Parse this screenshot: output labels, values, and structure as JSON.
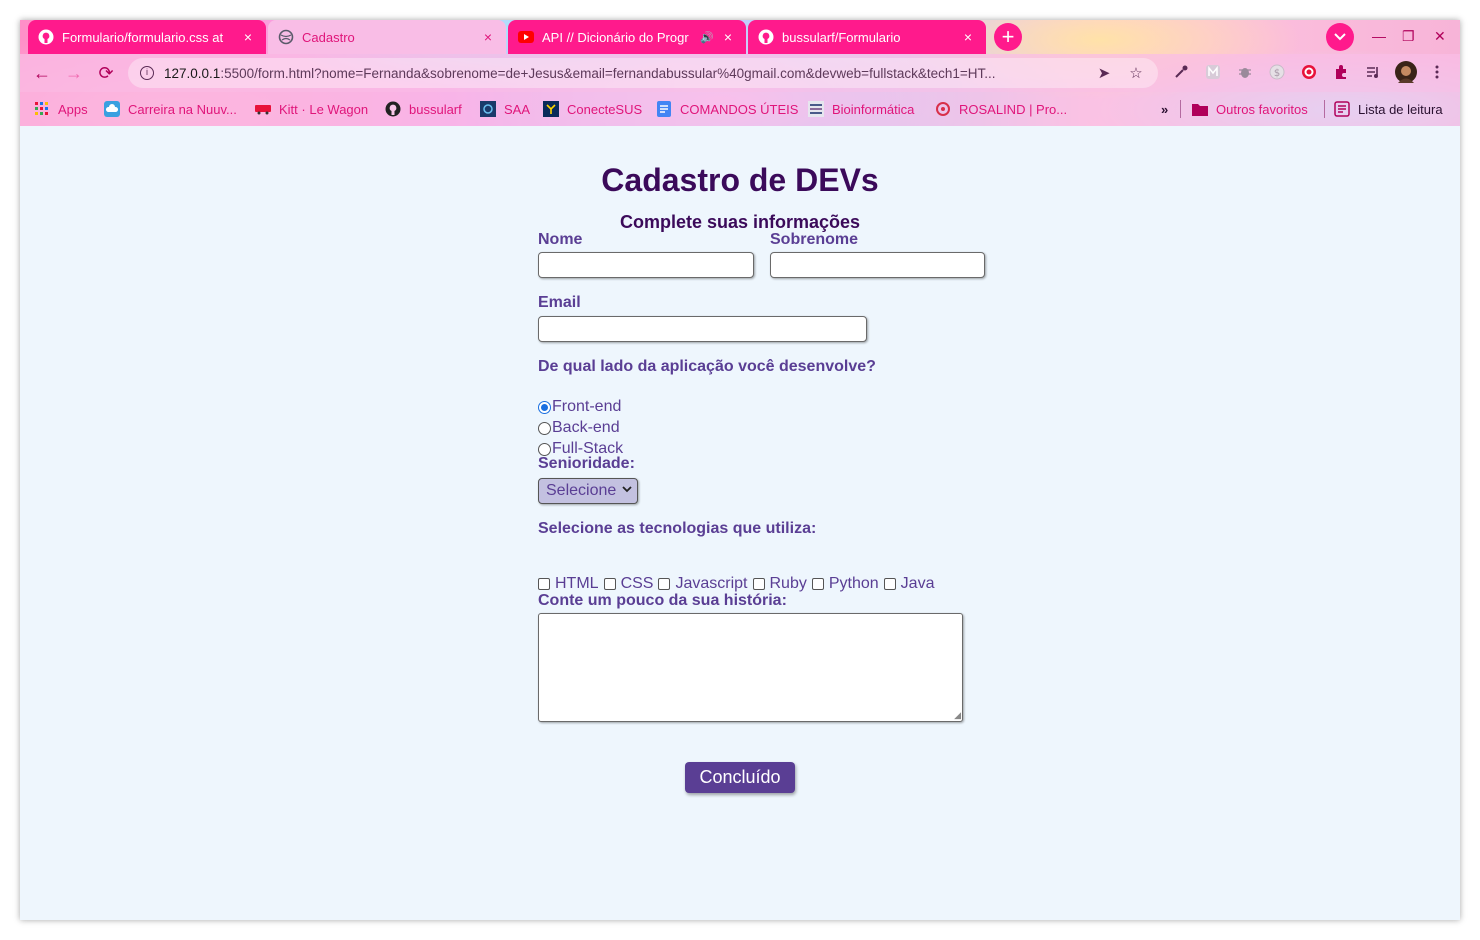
{
  "tabs": [
    {
      "title": "Formulario/formulario.css at",
      "favicon": "github-icon",
      "close": "×"
    },
    {
      "title": "Cadastro",
      "favicon": "globe-icon",
      "close": "×"
    },
    {
      "title": "API // Dicionário do Progr",
      "favicon": "youtube-icon",
      "close": "×",
      "audio": "🔊"
    },
    {
      "title": "bussularf/Formulario",
      "favicon": "github-icon",
      "close": "×"
    }
  ],
  "new_tab": "+",
  "tab_search": "⌄",
  "window_controls": {
    "minimize": "—",
    "restore": "❐",
    "close": "✕"
  },
  "nav": {
    "back": "←",
    "forward": "→",
    "reload": "⟳"
  },
  "address_bar": {
    "host": "127.0.0.1",
    "rest": ":5500/form.html?nome=Fernanda&sobrenome=de+Jesus&email=fernandabussular%40gmail.com&devweb=fullstack&tech1=HT...",
    "info_glyph": "i",
    "send_glyph": "➤",
    "star_glyph": "☆"
  },
  "extensions": [
    "eyedropper-icon",
    "m-extension-icon",
    "bug-icon",
    "dollar-icon",
    "target-icon",
    "puzzle-icon",
    "media-icon",
    "profile-avatar",
    "menu-icon"
  ],
  "bookmarks": [
    {
      "label": "Apps",
      "icon": "apps-grid-icon"
    },
    {
      "label": "Carreira na Nuuv...",
      "icon": "cloud-icon"
    },
    {
      "label": "Kitt · Le Wagon",
      "icon": "wagon-icon"
    },
    {
      "label": "bussularf",
      "icon": "github-icon"
    },
    {
      "label": "SAA",
      "icon": "saa-icon"
    },
    {
      "label": "ConecteSUS",
      "icon": "conectesus-icon"
    },
    {
      "label": "COMANDOS ÚTEIS",
      "icon": "doc-icon"
    },
    {
      "label": "Bioinformática",
      "icon": "bio-icon"
    },
    {
      "label": "ROSALIND | Pro...",
      "icon": "rosalind-icon"
    }
  ],
  "bookmarks_overflow": "»",
  "other_bookmarks": "Outros favoritos",
  "reading_list": "Lista de leitura",
  "form": {
    "title": "Cadastro de DEVs",
    "subtitle": "Complete suas informações",
    "nome_label": "Nome",
    "nome_value": "",
    "sobrenome_label": "Sobrenome",
    "sobrenome_value": "",
    "email_label": "Email",
    "email_value": "",
    "side_question": "De qual lado da aplicação você desenvolve?",
    "side_options": [
      {
        "label": "Front-end",
        "checked": true
      },
      {
        "label": "Back-end",
        "checked": false
      },
      {
        "label": "Full-Stack",
        "checked": false
      }
    ],
    "seniority_label": "Senioridade:",
    "seniority_selected": "Selecione",
    "tech_label": "Selecione as tecnologias que utiliza:",
    "tech_options": [
      "HTML",
      "CSS",
      "Javascript",
      "Ruby",
      "Python",
      "Java"
    ],
    "history_label": "Conte um pouco da sua história:",
    "history_value": "",
    "submit_label": "Concluído"
  },
  "colors": {
    "accent_pink": "#ff1a8c",
    "page_bg": "#eef6fd",
    "heading": "#3b0a5a",
    "label": "#5a3e94",
    "button": "#5a3e94"
  }
}
